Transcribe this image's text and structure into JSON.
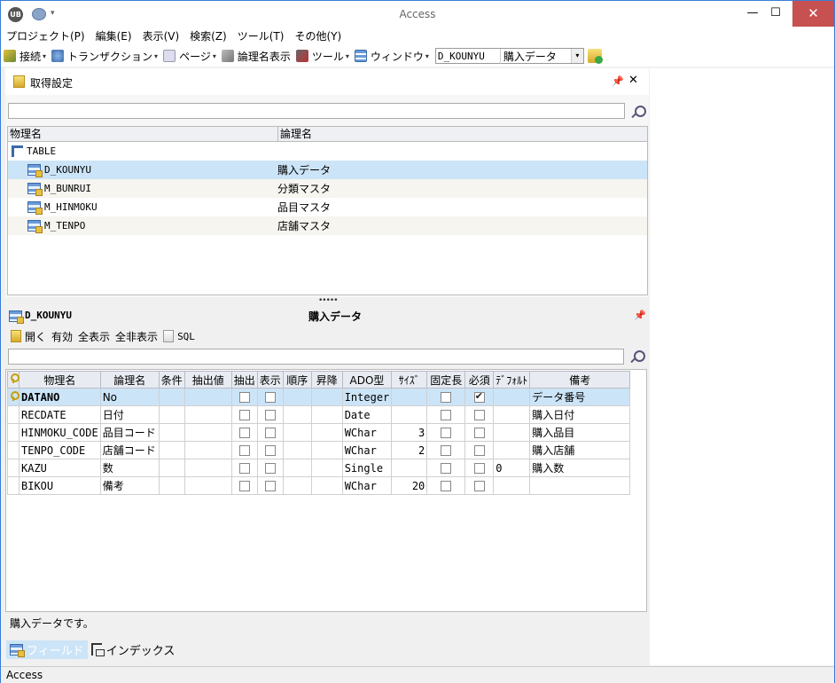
{
  "window": {
    "title": "Access",
    "app_logo": "UB",
    "minimize": "—",
    "maximize": "☐",
    "close": "✕"
  },
  "menu": [
    "プロジェクト(P)",
    "編集(E)",
    "表示(V)",
    "検索(Z)",
    "ツール(T)",
    "その他(Y)"
  ],
  "toolbar": {
    "connect": "接続",
    "transaction": "トランザクション",
    "page": "ページ",
    "logical_view": "論理名表示",
    "tools": "ツール",
    "window": "ウィンドウ",
    "context_physical": "D_KOUNYU",
    "context_logical": "購入データ"
  },
  "top_panel": {
    "title": "取得設定",
    "pin": "ㅁ",
    "close": "✕",
    "search_value": "",
    "columns": [
      "物理名",
      "論理名"
    ],
    "root": "TABLE",
    "rows": [
      {
        "physical": "D_KOUNYU",
        "logical": "購入データ",
        "selected": true
      },
      {
        "physical": "M_BUNRUI",
        "logical": "分類マスタ",
        "selected": false
      },
      {
        "physical": "M_HINMOKU",
        "logical": "品目マスタ",
        "selected": false
      },
      {
        "physical": "M_TENPO",
        "logical": "店舗マスタ",
        "selected": false
      }
    ]
  },
  "splitter": "•••••",
  "bottom_panel": {
    "physical": "D_KOUNYU",
    "logical": "購入データ",
    "pin": "ㅁ",
    "tools": [
      "開く",
      "有効",
      "全表示",
      "全非表示",
      "SQL"
    ],
    "search_value": "",
    "columns": [
      "物理名",
      "論理名",
      "条件",
      "抽出値",
      "抽出",
      "表示",
      "順序",
      "昇降",
      "ADO型",
      "ｻｲｽﾞ",
      "固定長",
      "必須",
      "ﾃﾞﾌｫﾙﾄ",
      "備考"
    ],
    "rows": [
      {
        "key": true,
        "physical": "DATANO",
        "logical": "No",
        "ado": "Integer",
        "size": "",
        "fixed": false,
        "required": true,
        "default": "",
        "note": "データ番号",
        "selected": true
      },
      {
        "key": false,
        "physical": "RECDATE",
        "logical": "日付",
        "ado": "Date",
        "size": "",
        "fixed": false,
        "required": false,
        "default": "",
        "note": "購入日付",
        "selected": false
      },
      {
        "key": false,
        "physical": "HINMOKU_CODE",
        "logical": "品目コード",
        "ado": "WChar",
        "size": "3",
        "fixed": false,
        "required": false,
        "default": "",
        "note": "購入品目",
        "selected": false
      },
      {
        "key": false,
        "physical": "TENPO_CODE",
        "logical": "店舗コード",
        "ado": "WChar",
        "size": "2",
        "fixed": false,
        "required": false,
        "default": "",
        "note": "購入店舗",
        "selected": false
      },
      {
        "key": false,
        "physical": "KAZU",
        "logical": "数",
        "ado": "Single",
        "size": "",
        "fixed": false,
        "required": false,
        "default": "0",
        "note": "購入数",
        "selected": false
      },
      {
        "key": false,
        "physical": "BIKOU",
        "logical": "備考",
        "ado": "WChar",
        "size": "20",
        "fixed": false,
        "required": false,
        "default": "",
        "note": "",
        "selected": false
      }
    ],
    "description": "購入データです。",
    "tabs": [
      "フィールド",
      "インデックス"
    ]
  },
  "statusbar": "Access"
}
